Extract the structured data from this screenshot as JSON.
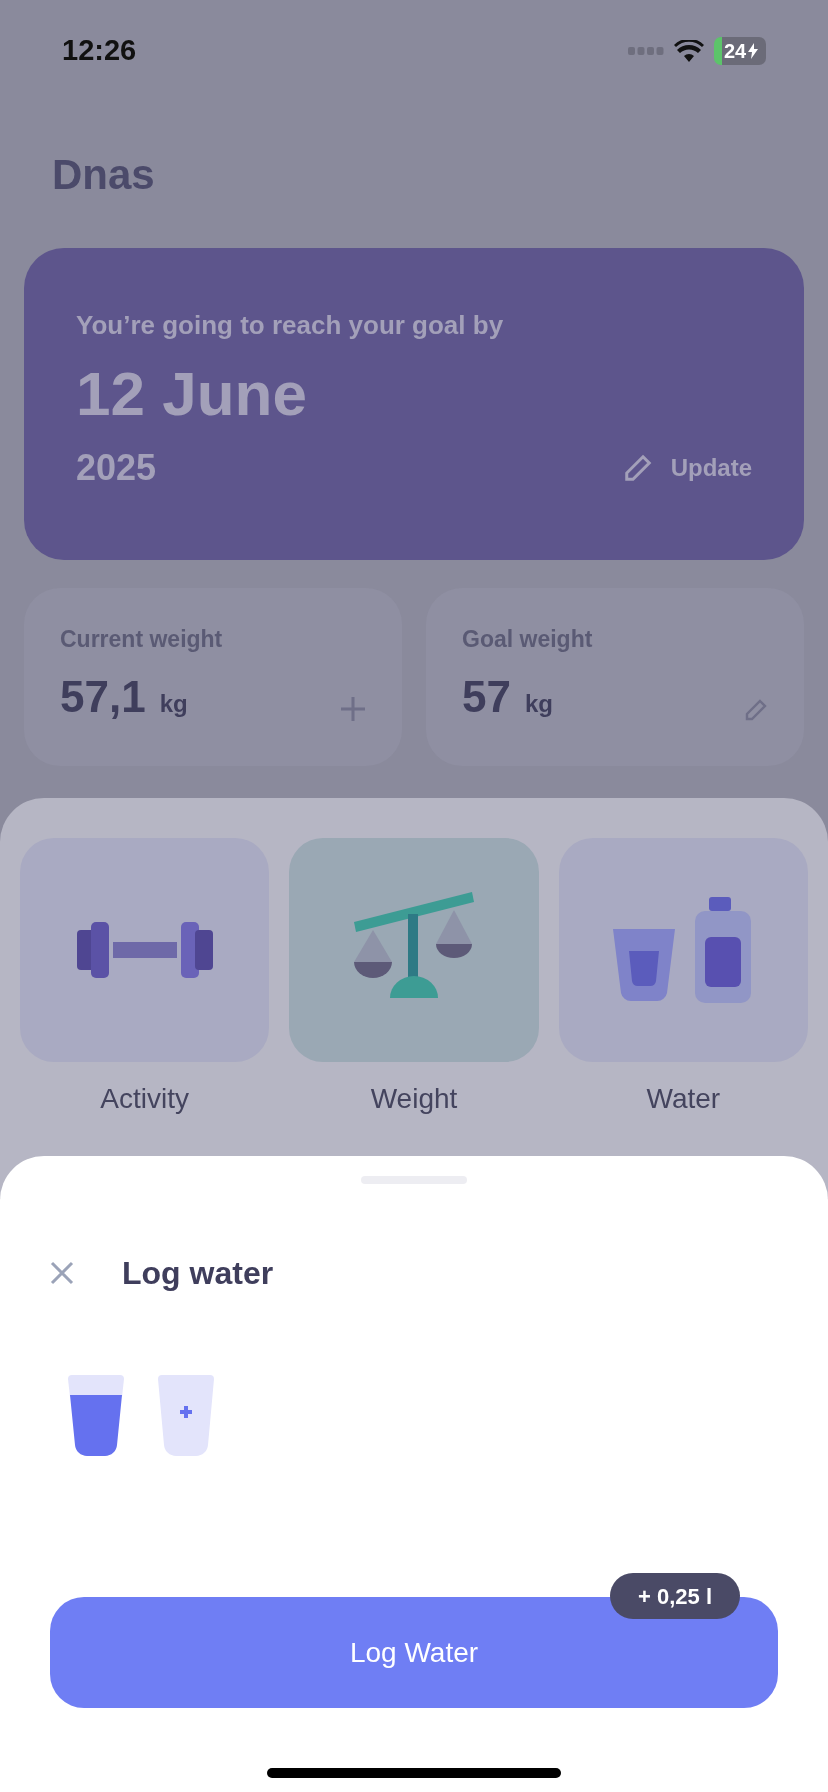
{
  "status_bar": {
    "time": "12:26",
    "battery": "24"
  },
  "title": "Dnas",
  "goal_card": {
    "caption": "You’re going to reach your goal by",
    "date": "12 June",
    "year": "2025",
    "action": "Update"
  },
  "weights": [
    {
      "label": "Current weight",
      "value": "57,1",
      "unit": "kg",
      "kind": "add"
    },
    {
      "label": "Goal weight",
      "value": "57",
      "unit": "kg",
      "kind": "edit"
    }
  ],
  "categories": [
    {
      "label": "Activity",
      "kind": "activity",
      "selected": false
    },
    {
      "label": "Weight",
      "kind": "weight",
      "selected": true
    },
    {
      "label": "Water",
      "kind": "water",
      "selected": false
    }
  ],
  "sheet": {
    "title": "Log water",
    "glasses": [
      {
        "filled": true
      },
      {
        "filled": false
      }
    ],
    "badge": "+ 0,25 l",
    "button": "Log Water"
  }
}
